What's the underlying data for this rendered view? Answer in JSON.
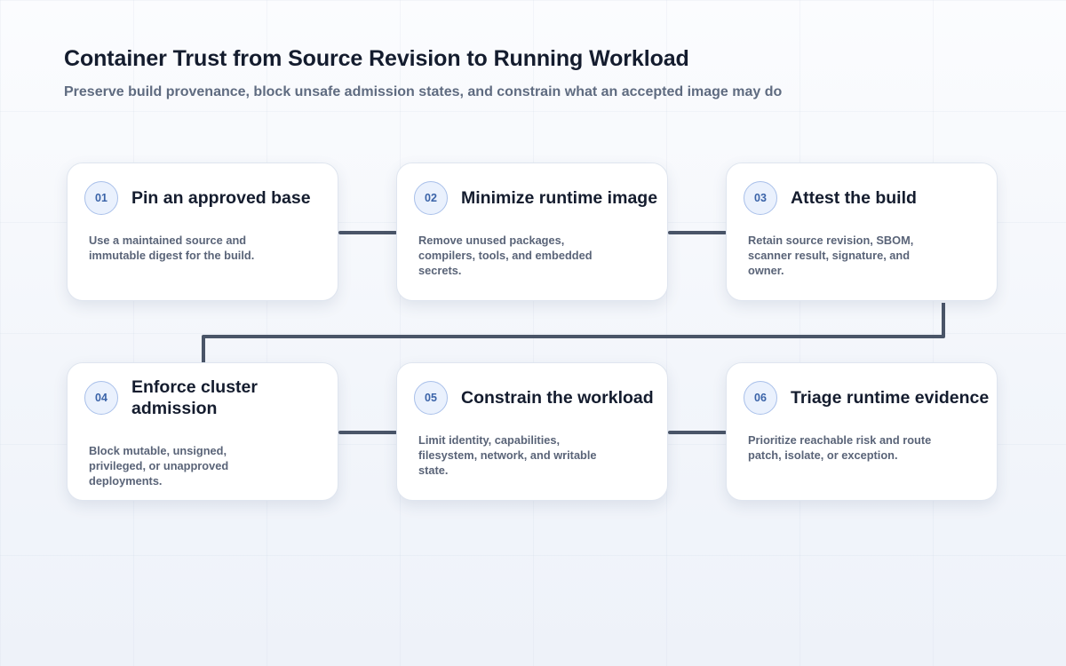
{
  "header": {
    "title": "Container Trust from Source Revision to Running Workload",
    "subtitle": "Preserve build provenance, block unsafe admission states, and constrain what an accepted image may do"
  },
  "steps": [
    {
      "number": "01",
      "title": "Pin an approved base",
      "description": "Use a maintained source and immutable digest for the build."
    },
    {
      "number": "02",
      "title": "Minimize runtime image",
      "description": "Remove unused packages, compilers, tools, and embedded secrets."
    },
    {
      "number": "03",
      "title": "Attest the build",
      "description": "Retain source revision, SBOM, scanner result, signature, and owner."
    },
    {
      "number": "04",
      "title": "Enforce cluster admission",
      "description": "Block mutable, unsigned, privileged, or unapproved deployments."
    },
    {
      "number": "05",
      "title": "Constrain the workload",
      "description": "Limit identity, capabilities, filesystem, network, and writable state."
    },
    {
      "number": "06",
      "title": "Triage runtime evidence",
      "description": "Prioritize reachable risk and route patch, isolate, or exception."
    }
  ],
  "colors": {
    "connector": "#4a5568",
    "badge_text": "#3a63a8",
    "badge_border": "#a9c0ea"
  }
}
